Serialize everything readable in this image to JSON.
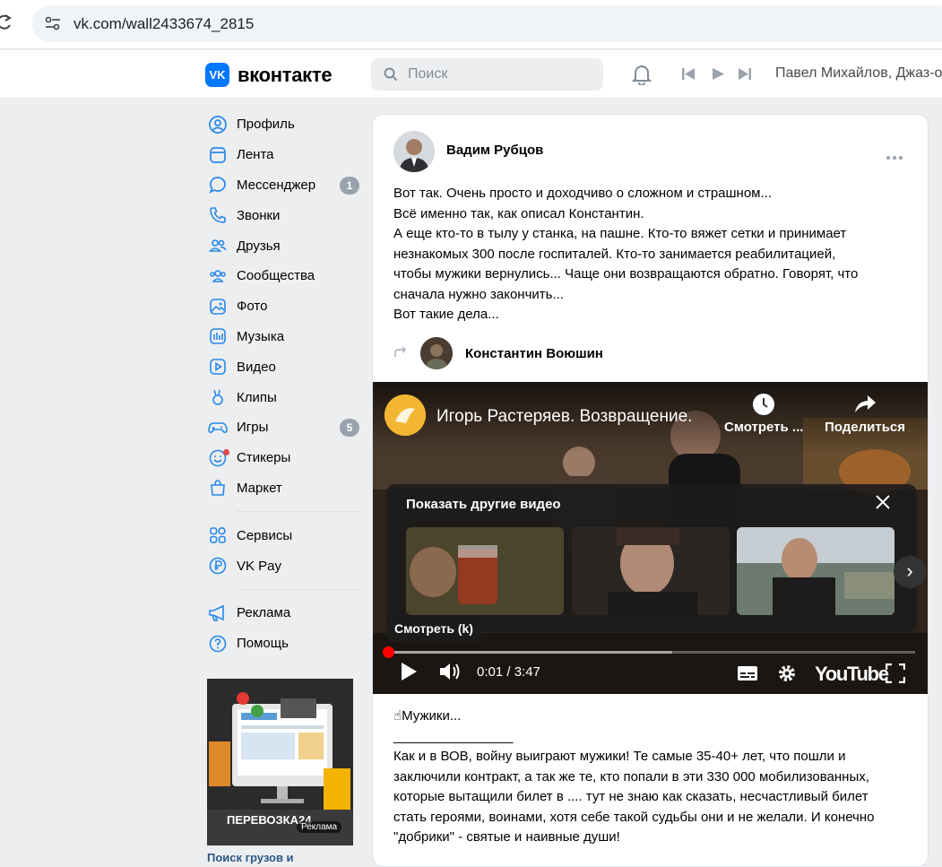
{
  "browser": {
    "url": "vk.com/wall2433674_2815"
  },
  "header": {
    "logo_text": "вконтакте",
    "logo_mark": "VK",
    "search_placeholder": "Поиск",
    "now_playing": "Павел Михайлов, Джаз-о"
  },
  "sidebar": {
    "items": [
      {
        "label": "Профиль",
        "icon": "user-circle-icon"
      },
      {
        "label": "Лента",
        "icon": "feed-icon"
      },
      {
        "label": "Мессенджер",
        "icon": "message-icon",
        "badge": "1"
      },
      {
        "label": "Звонки",
        "icon": "phone-icon"
      },
      {
        "label": "Друзья",
        "icon": "friends-icon"
      },
      {
        "label": "Сообщества",
        "icon": "groups-icon"
      },
      {
        "label": "Фото",
        "icon": "photo-icon"
      },
      {
        "label": "Музыка",
        "icon": "music-icon"
      },
      {
        "label": "Видео",
        "icon": "video-icon"
      },
      {
        "label": "Клипы",
        "icon": "clips-icon"
      },
      {
        "label": "Игры",
        "icon": "gamepad-icon",
        "badge": "5"
      },
      {
        "label": "Стикеры",
        "icon": "sticker-icon"
      },
      {
        "label": "Маркет",
        "icon": "market-icon"
      }
    ],
    "services": [
      {
        "label": "Сервисы",
        "icon": "grid-icon"
      },
      {
        "label": "VK Pay",
        "icon": "vkpay-icon"
      }
    ],
    "extra": [
      {
        "label": "Реклама",
        "icon": "megaphone-icon"
      },
      {
        "label": "Помощь",
        "icon": "help-icon"
      }
    ],
    "ad": {
      "brand": "ПЕРЕВОЗКА24",
      "tag": "Реклама",
      "caption": "Поиск грузов и"
    }
  },
  "post": {
    "author": "Вадим Рубцов",
    "text_lines": [
      "Вот так. Очень просто и доходчиво о сложном и страшном...",
      "Всё именно так, как описал Константин.",
      "А еще кто-то в тылу у станка, на пашне. Кто-то вяжет сетки и принимает",
      "незнакомых 300 после госпиталей. Кто-то занимается реабилитацией,",
      "чтобы мужики вернулись... Чаще они возвращаются обратно. Говорят, что",
      "сначала нужно закончить...",
      "Вот такие дела..."
    ],
    "repost_author": "Константин Воюшин",
    "video": {
      "title": "Игорь Растеряев. Возвращение.",
      "watch_later": "Смотреть ...",
      "share": "Поделиться",
      "suggest_title": "Показать другие видео",
      "watch_key": "Смотреть (k)",
      "time": "0:01 / 3:47",
      "buffered_fraction": 0.54,
      "played_fraction": 0.003,
      "youtube": "YouTube"
    },
    "text2_lines": [
      "☝Мужики...",
      "________________",
      "Как и в ВОВ, войну выиграют мужики! Те самые 35-40+ лет, что пошли и",
      "заключили контракт, а так же те, кто попали в эти 330 000 мобилизованных,",
      "которые вытащили билет в .... тут не знаю как сказать, несчастливый билет",
      "стать героями, воинами, хотя себе такой судьбы они и не желали. И конечно",
      "\"добрики\" - святые и наивные души!"
    ]
  }
}
